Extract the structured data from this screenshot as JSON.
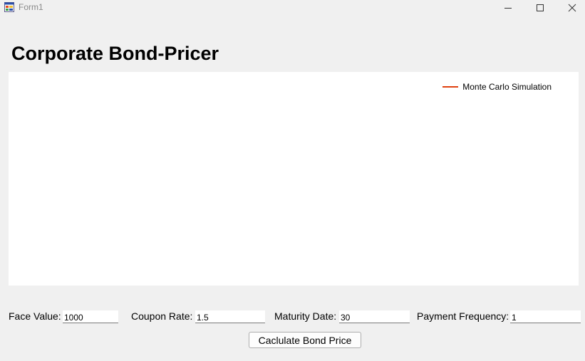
{
  "window": {
    "title": "Form1",
    "icon": "winforms-app-icon",
    "controls": [
      "minimize-icon",
      "maximize-icon",
      "close-icon"
    ]
  },
  "header": {
    "title": "Corporate Bond-Pricer"
  },
  "chart": {
    "legend": [
      {
        "name": "Monte Carlo Simulation",
        "color": "#e0400f"
      }
    ]
  },
  "chart_data": {
    "type": "line",
    "series": [
      {
        "name": "Monte Carlo Simulation",
        "values": []
      }
    ],
    "legend_position": "top-right"
  },
  "form": {
    "face_value": {
      "label": "Face Value:",
      "value": "1000"
    },
    "coupon_rate": {
      "label": "Coupon Rate:",
      "value": "1.5"
    },
    "maturity_date": {
      "label": "Maturity Date:",
      "value": "30"
    },
    "payment_frequency": {
      "label": "Payment Frequency:",
      "value": "1"
    },
    "calculate_button": "Caclulate Bond Price"
  }
}
